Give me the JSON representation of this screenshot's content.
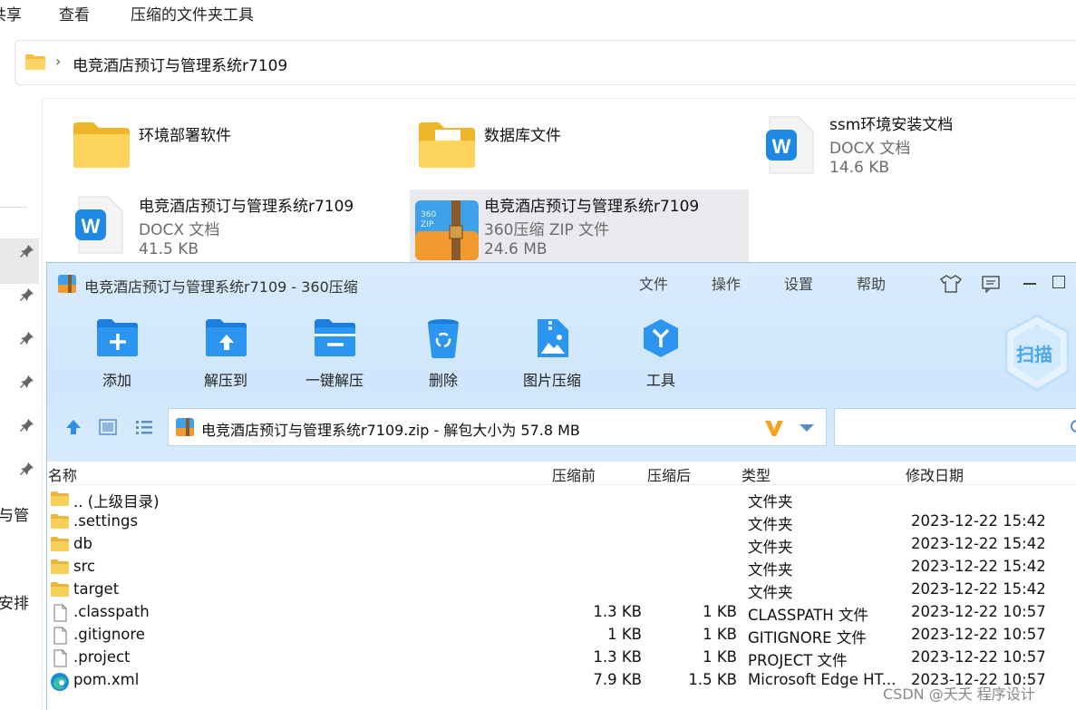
{
  "explorer": {
    "menu": [
      "共享",
      "查看",
      "压缩的文件夹工具"
    ],
    "address": "电竞酒店预订与管理系统r7109",
    "left_cut_texts": [
      "与管",
      "安排"
    ],
    "tiles": [
      {
        "name": "环境部署软件",
        "type": "",
        "size": "",
        "icon": "folder-icon"
      },
      {
        "name": "数据库文件",
        "type": "",
        "size": "",
        "icon": "folder-icon"
      },
      {
        "name": "ssm环境安装文档",
        "type": "DOCX 文档",
        "size": "14.6 KB",
        "icon": "wps-doc-icon"
      },
      {
        "name": "电竞酒店预订与管理系统r7109",
        "type": "DOCX 文档",
        "size": "41.5 KB",
        "icon": "wps-doc-icon"
      },
      {
        "name": "电竞酒店预订与管理系统r7109",
        "type": "360压缩 ZIP 文件",
        "size": "24.6 MB",
        "icon": "zip-archive-icon"
      }
    ]
  },
  "zip": {
    "title": "电竞酒店预订与管理系统r7109 - 360压缩",
    "menu": [
      "文件",
      "操作",
      "设置",
      "帮助"
    ],
    "toolbar": [
      "添加",
      "解压到",
      "一键解压",
      "删除",
      "图片压缩",
      "工具"
    ],
    "scan_label": "扫描",
    "path": "电竞酒店预订与管理系统r7109.zip - 解包大小为 57.8 MB",
    "columns": [
      "名称",
      "压缩前",
      "压缩后",
      "类型",
      "修改日期"
    ],
    "rows": [
      {
        "name": ".. (上级目录)",
        "before": "",
        "after": "",
        "type": "文件夹",
        "date": "",
        "icon": "folder"
      },
      {
        "name": ".settings",
        "before": "",
        "after": "",
        "type": "文件夹",
        "date": "2023-12-22 15:42",
        "icon": "folder"
      },
      {
        "name": "db",
        "before": "",
        "after": "",
        "type": "文件夹",
        "date": "2023-12-22 15:42",
        "icon": "folder"
      },
      {
        "name": "src",
        "before": "",
        "after": "",
        "type": "文件夹",
        "date": "2023-12-22 15:42",
        "icon": "folder"
      },
      {
        "name": "target",
        "before": "",
        "after": "",
        "type": "文件夹",
        "date": "2023-12-22 15:42",
        "icon": "folder"
      },
      {
        "name": ".classpath",
        "before": "1.3 KB",
        "after": "1 KB",
        "type": "CLASSPATH 文件",
        "date": "2023-12-22 10:57",
        "icon": "file"
      },
      {
        "name": ".gitignore",
        "before": "1 KB",
        "after": "1 KB",
        "type": "GITIGNORE 文件",
        "date": "2023-12-22 10:57",
        "icon": "file"
      },
      {
        "name": ".project",
        "before": "1.3 KB",
        "after": "1 KB",
        "type": "PROJECT 文件",
        "date": "2023-12-22 10:57",
        "icon": "file"
      },
      {
        "name": "pom.xml",
        "before": "7.9 KB",
        "after": "1.5 KB",
        "type": "Microsoft Edge HT...",
        "date": "2023-12-22 10:57",
        "icon": "edge"
      }
    ]
  },
  "watermark": "CSDN @夭夭 程序设计",
  "colors": {
    "accent": "#1e88e5",
    "zip_bg": "#d4e9fd",
    "folder": "#f5c542"
  }
}
